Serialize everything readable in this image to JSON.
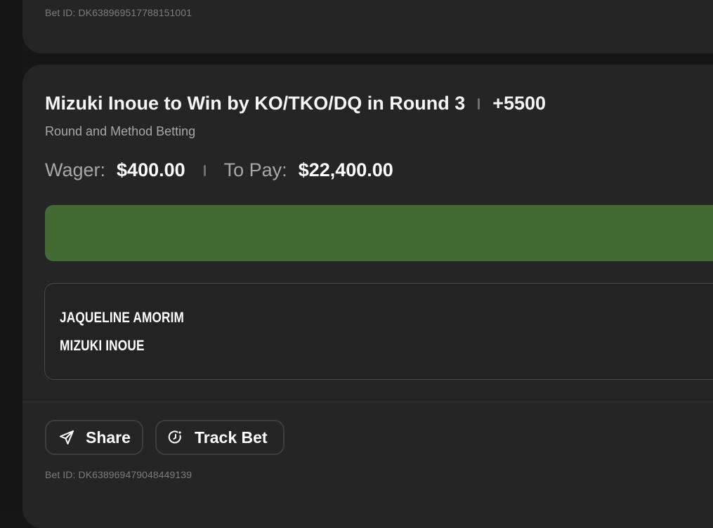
{
  "previous_bet": {
    "bet_id": "Bet ID: DK638969517788151001"
  },
  "bet": {
    "selection": "Mizuki Inoue to Win by KO/TKO/DQ in Round 3",
    "odds": "+5500",
    "market": "Round and Method Betting",
    "wager_label": "Wager:",
    "wager_value": "$400.00",
    "to_pay_label": "To Pay:",
    "to_pay_value": "$22,400.00",
    "status_color": "#436a33",
    "fighters": [
      "JAQUELINE AMORIM",
      "MIZUKI INOUE"
    ],
    "share_label": "Share",
    "share_icon": "send-icon",
    "track_label": "Track Bet",
    "track_icon": "track-icon",
    "bet_id": "Bet ID: DK638969479048449139"
  }
}
